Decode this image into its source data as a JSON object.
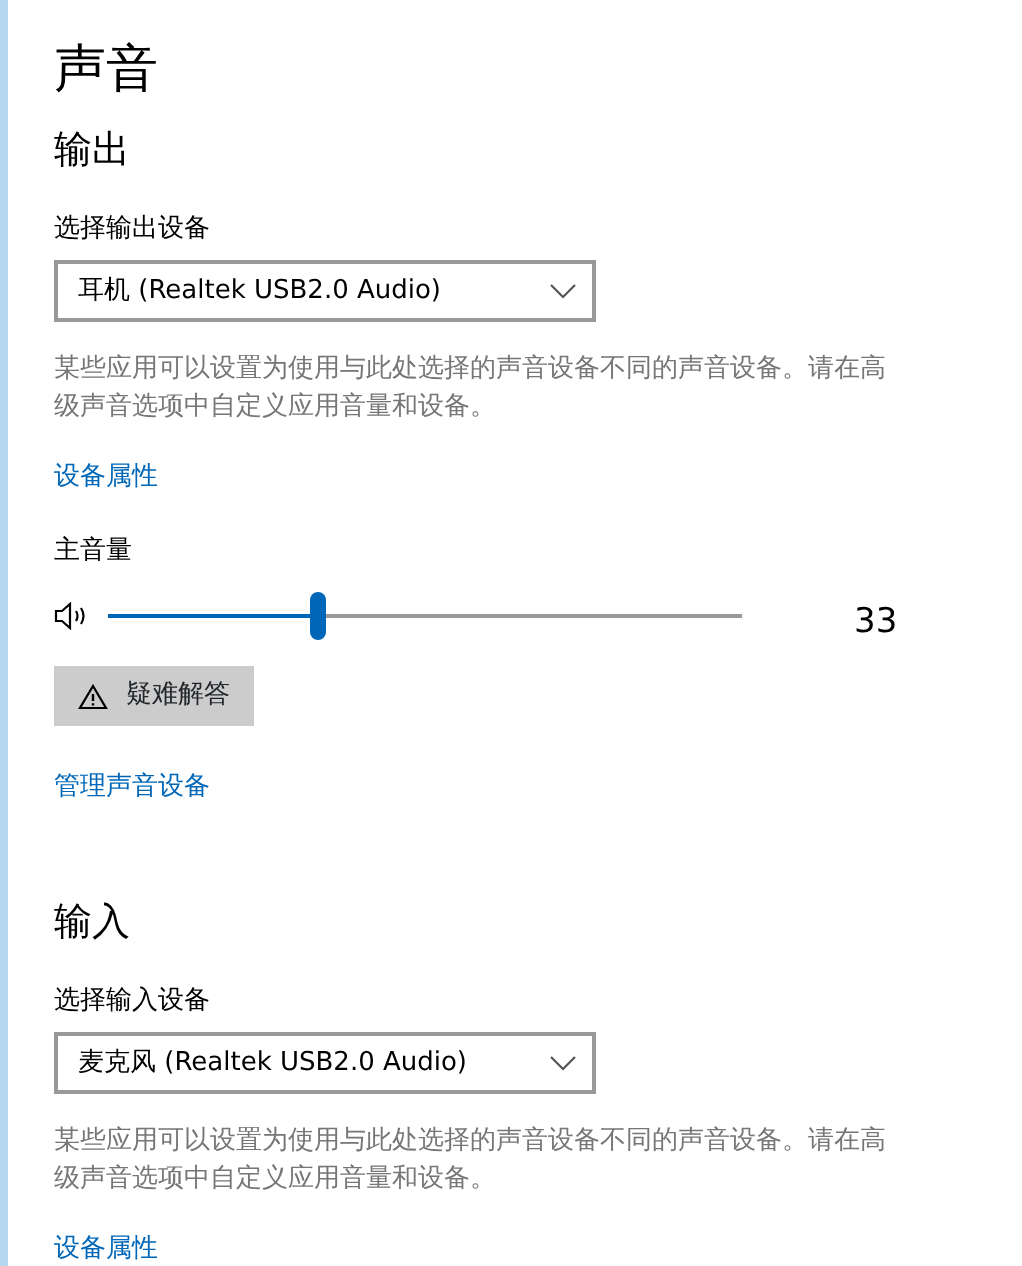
{
  "title": "声音",
  "output": {
    "heading": "输出",
    "device_label": "选择输出设备",
    "device": "耳机 (Realtek USB2.0 Audio)",
    "description": "某些应用可以设置为使用与此处选择的声音设备不同的声音设备。请在高级声音选项中自定义应用音量和设备。",
    "properties_link": "设备属性",
    "volume": {
      "label": "主音量",
      "level": 0.33,
      "reading": "33"
    },
    "troubleshoot_button": "疑难解答",
    "manage_link": "管理声音设备"
  },
  "input": {
    "heading": "输入",
    "device_label": "选择输入设备",
    "device": "麦克风 (Realtek USB2.0 Audio)",
    "description": "某些应用可以设置为使用与此处选择的声音设备不同的声音设备。请在高级声音选项中自定义应用音量和设备。",
    "properties_link": "设备属性"
  }
}
